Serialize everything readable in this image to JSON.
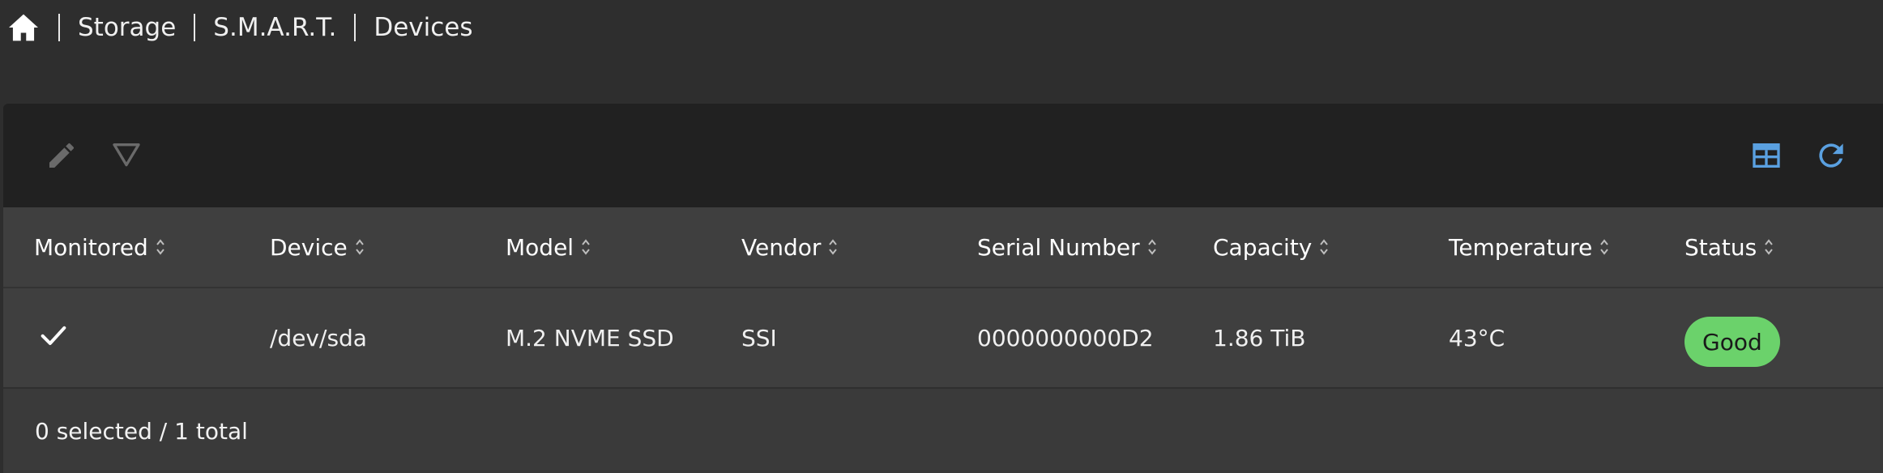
{
  "breadcrumb": {
    "home_icon": "home-icon",
    "items": [
      "Storage",
      "S.M.A.R.T.",
      "Devices"
    ]
  },
  "toolbar": {
    "left_icons": [
      "edit-icon",
      "filter-icon"
    ],
    "right_icons": [
      "table-layout-icon",
      "refresh-icon"
    ],
    "accent_color": "#5aa0e0",
    "disabled_color": "#6a6a6a"
  },
  "table": {
    "columns": [
      "Monitored",
      "Device",
      "Model",
      "Vendor",
      "Serial Number",
      "Capacity",
      "Temperature",
      "Status"
    ],
    "rows": [
      {
        "monitored": "checkmark-icon",
        "device": "/dev/sda",
        "model": "M.2 NVME SSD",
        "vendor": "SSI",
        "serial": "0000000000D2",
        "capacity": "1.86 TiB",
        "temperature": "43°C",
        "status": "Good",
        "status_color": "#6bd26b"
      }
    ]
  },
  "footer": {
    "summary": "0 selected / 1 total"
  }
}
